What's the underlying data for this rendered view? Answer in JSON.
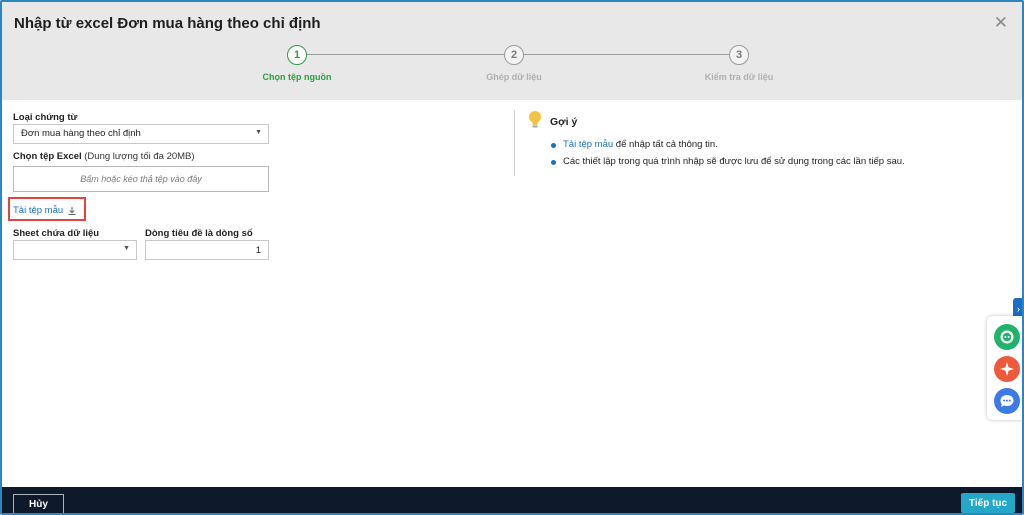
{
  "dialog": {
    "title": "Nhập từ excel Đơn mua hàng theo chỉ định"
  },
  "steps": [
    {
      "number": "1",
      "label": "Chọn tệp nguồn",
      "state": "active"
    },
    {
      "number": "2",
      "label": "Ghép dữ liệu",
      "state": "inactive"
    },
    {
      "number": "3",
      "label": "Kiểm tra dữ liệu",
      "state": "inactive"
    }
  ],
  "form": {
    "voucher_type_label": "Loại chứng từ",
    "voucher_type_value": "Đơn mua hàng theo chỉ định",
    "file_label": "Chọn tệp Excel",
    "file_hint": "(Dung lượng tối đa 20MB)",
    "dropzone_text": "Bấm hoặc kéo thả tệp vào đây",
    "download_template": "Tải tệp mẫu",
    "sheet_label": "Sheet chứa dữ liệu",
    "sheet_value": "",
    "header_row_label": "Dòng tiêu đề là dòng số",
    "header_row_value": "1"
  },
  "tips": {
    "title": "Gợi ý",
    "item1_link": "Tải tệp mẫu",
    "item1_text": " để nhập tất cả thông tin.",
    "item2_text": "Các thiết lập trong quá trình nhập sẽ được lưu để sử dụng trong các lần tiếp sau."
  },
  "footer": {
    "cancel_label": "Hủy",
    "next_label": "Tiếp tục"
  },
  "icons": [
    "close-icon",
    "chevron-down-icon",
    "download-icon",
    "lightbulb-icon",
    "chevron-right-icon",
    "assistant-icon",
    "sparkle-icon",
    "chat-icon"
  ],
  "colors": {
    "accent_green": "#2aa13d",
    "link_blue": "#1a6fc4",
    "footer_bg": "#0e1a2b",
    "primary_button": "#23a8c8",
    "highlight_red": "#e0443c"
  }
}
